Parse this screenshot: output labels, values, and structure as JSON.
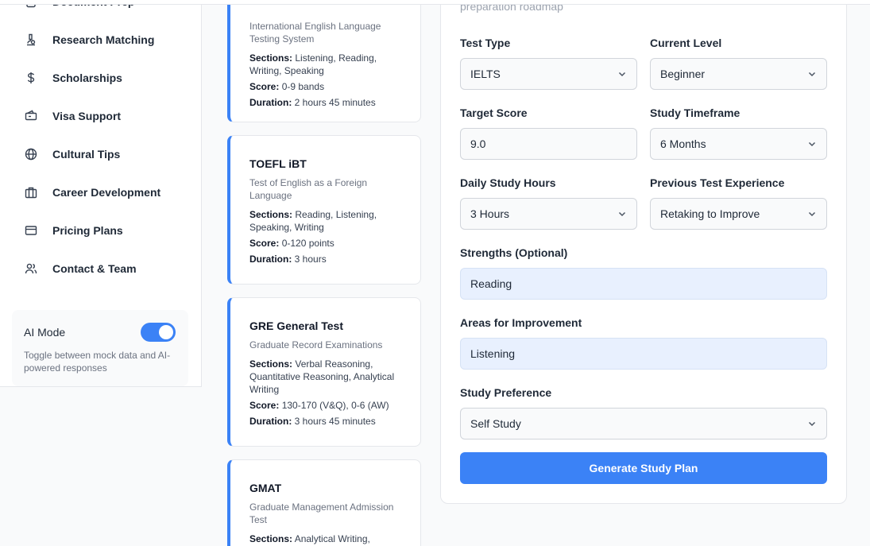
{
  "sidebar": {
    "items": [
      {
        "label": "Document Prep",
        "icon": "document-icon"
      },
      {
        "label": "Research Matching",
        "icon": "microscope-icon"
      },
      {
        "label": "Scholarships",
        "icon": "dollar-icon"
      },
      {
        "label": "Visa Support",
        "icon": "ticket-icon"
      },
      {
        "label": "Cultural Tips",
        "icon": "globe-icon"
      },
      {
        "label": "Career Development",
        "icon": "briefcase-icon"
      },
      {
        "label": "Pricing Plans",
        "icon": "credit-card-icon"
      },
      {
        "label": "Contact & Team",
        "icon": "users-icon"
      }
    ],
    "ai_mode": {
      "title": "AI Mode",
      "description": "Toggle between mock data and AI-powered responses",
      "enabled": true
    }
  },
  "tests": [
    {
      "name": "",
      "full_name": "International English Language Testing System",
      "sections_label": "Sections:",
      "sections": "Listening, Reading, Writing, Speaking",
      "score_label": "Score:",
      "score": "0-9 bands",
      "duration_label": "Duration:",
      "duration": "2 hours 45 minutes"
    },
    {
      "name": "TOEFL iBT",
      "full_name": "Test of English as a Foreign Language",
      "sections_label": "Sections:",
      "sections": "Reading, Listening, Speaking, Writing",
      "score_label": "Score:",
      "score": "0-120 points",
      "duration_label": "Duration:",
      "duration": "3 hours"
    },
    {
      "name": "GRE General Test",
      "full_name": "Graduate Record Examinations",
      "sections_label": "Sections:",
      "sections": "Verbal Reasoning, Quantitative Reasoning, Analytical Writing",
      "score_label": "Score:",
      "score": "130-170 (V&Q), 0-6 (AW)",
      "duration_label": "Duration:",
      "duration": "3 hours 45 minutes"
    },
    {
      "name": "GMAT",
      "full_name": "Graduate Management Admission Test",
      "sections_label": "Sections:",
      "sections": "Analytical Writing,"
    }
  ],
  "form": {
    "subtitle": "preparation roadmap",
    "test_type": {
      "label": "Test Type",
      "value": "IELTS"
    },
    "current_level": {
      "label": "Current Level",
      "value": "Beginner"
    },
    "target_score": {
      "label": "Target Score",
      "value": "9.0"
    },
    "study_timeframe": {
      "label": "Study Timeframe",
      "value": "6 Months"
    },
    "daily_hours": {
      "label": "Daily Study Hours",
      "value": "3 Hours"
    },
    "previous_experience": {
      "label": "Previous Test Experience",
      "value": "Retaking to Improve"
    },
    "strengths": {
      "label": "Strengths (Optional)",
      "value": "Reading"
    },
    "improvement": {
      "label": "Areas for Improvement",
      "value": "Listening"
    },
    "preference": {
      "label": "Study Preference",
      "value": "Self Study"
    },
    "submit_label": "Generate Study Plan"
  },
  "colors": {
    "accent": "#3b82f6",
    "input_highlight": "#e8f0fe"
  }
}
